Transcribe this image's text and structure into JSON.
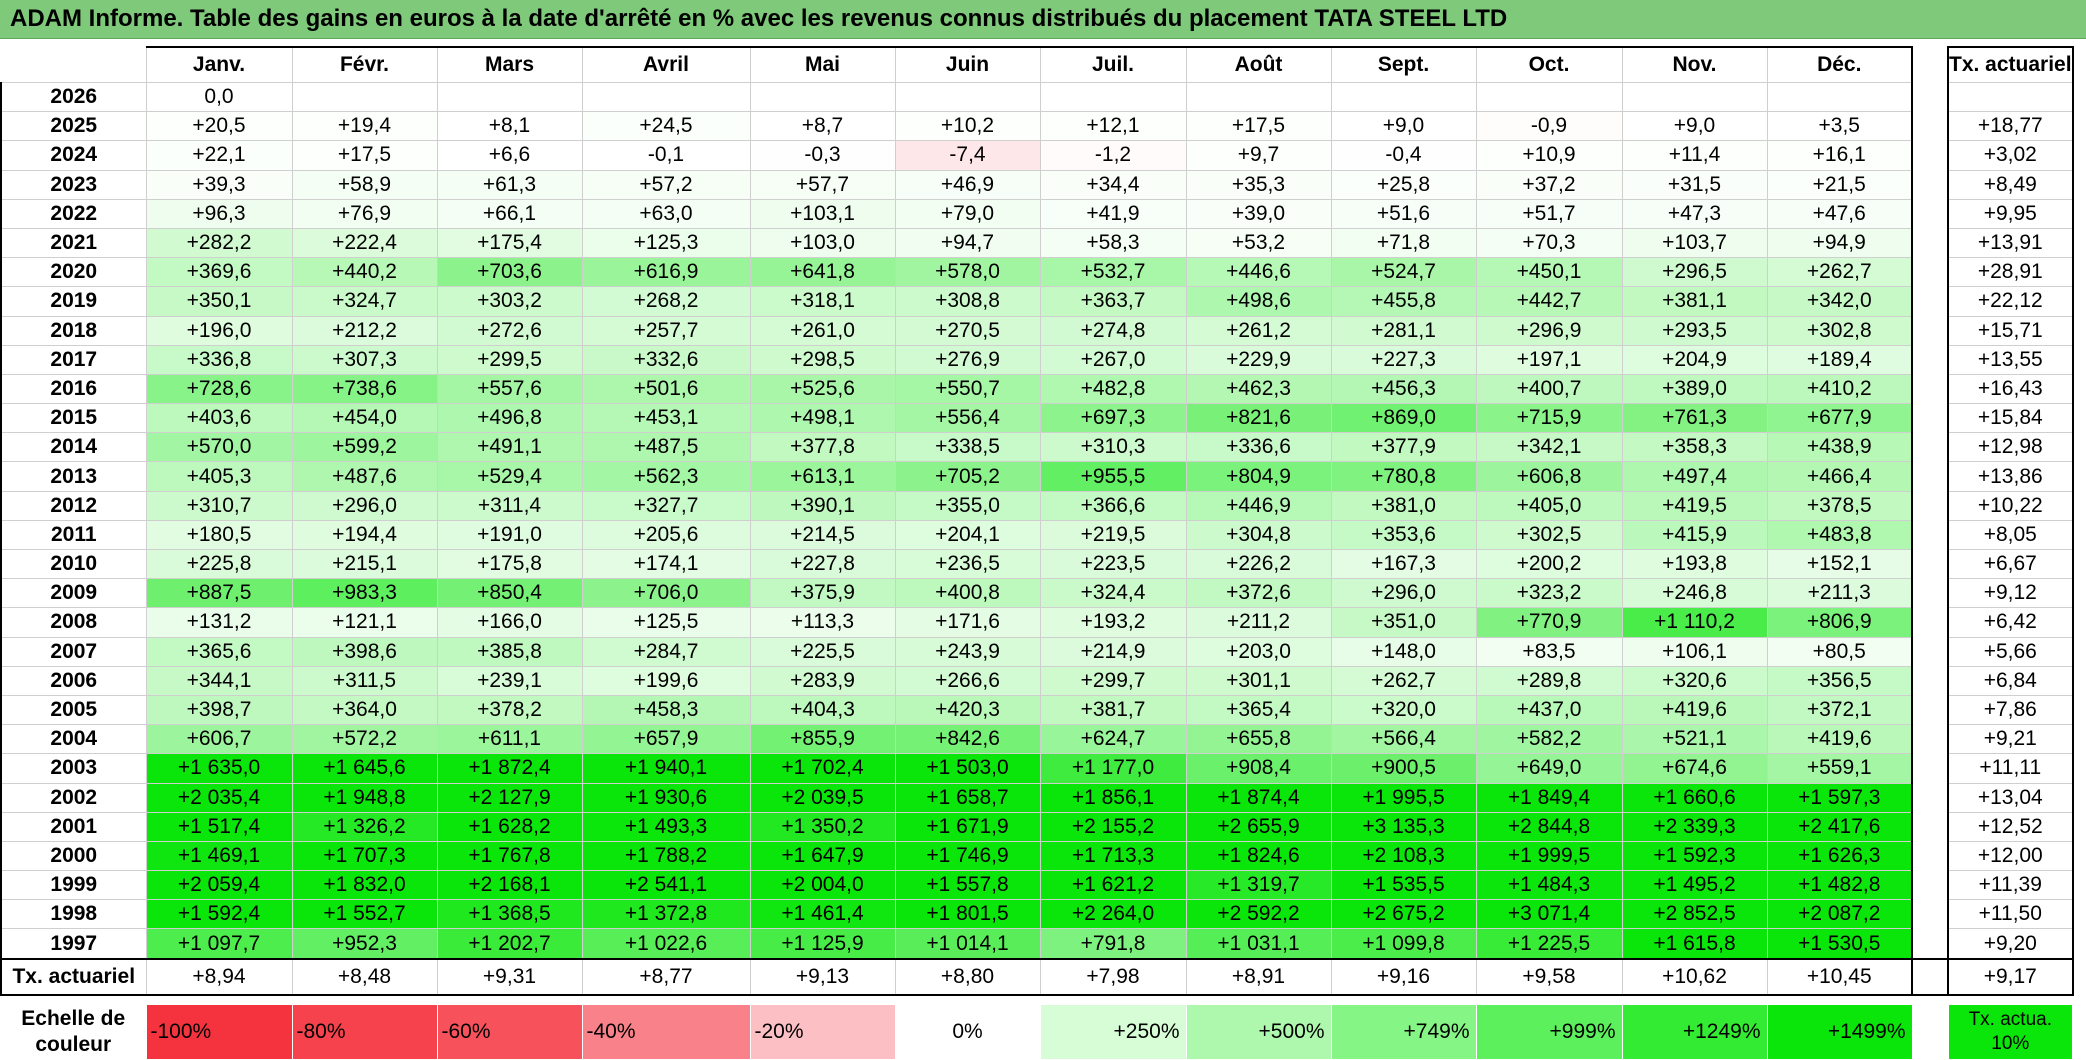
{
  "title": "ADAM Informe. Table des gains en euros à la date d'arrêté en % avec les revenus connus distribués du placement TATA STEEL LTD",
  "months": [
    "Janv.",
    "Févr.",
    "Mars",
    "Avril",
    "Mai",
    "Juin",
    "Juil.",
    "Août",
    "Sept.",
    "Oct.",
    "Nov.",
    "Déc."
  ],
  "tx_header": "Tx. actuariel",
  "rows": [
    {
      "year": "2026",
      "values": [
        "0,0",
        "",
        "",
        "",
        "",
        "",
        "",
        "",
        "",
        "",
        "",
        ""
      ],
      "tx": ""
    },
    {
      "year": "2025",
      "values": [
        "+20,5",
        "+19,4",
        "+8,1",
        "+24,5",
        "+8,7",
        "+10,2",
        "+12,1",
        "+17,5",
        "+9,0",
        "-0,9",
        "+9,0",
        "+3,5"
      ],
      "tx": "+18,77"
    },
    {
      "year": "2024",
      "values": [
        "+22,1",
        "+17,5",
        "+6,6",
        "-0,1",
        "-0,3",
        "-7,4",
        "-1,2",
        "+9,7",
        "-0,4",
        "+10,9",
        "+11,4",
        "+16,1"
      ],
      "tx": "+3,02"
    },
    {
      "year": "2023",
      "values": [
        "+39,3",
        "+58,9",
        "+61,3",
        "+57,2",
        "+57,7",
        "+46,9",
        "+34,4",
        "+35,3",
        "+25,8",
        "+37,2",
        "+31,5",
        "+21,5"
      ],
      "tx": "+8,49"
    },
    {
      "year": "2022",
      "values": [
        "+96,3",
        "+76,9",
        "+66,1",
        "+63,0",
        "+103,1",
        "+79,0",
        "+41,9",
        "+39,0",
        "+51,6",
        "+51,7",
        "+47,3",
        "+47,6"
      ],
      "tx": "+9,95"
    },
    {
      "year": "2021",
      "values": [
        "+282,2",
        "+222,4",
        "+175,4",
        "+125,3",
        "+103,0",
        "+94,7",
        "+58,3",
        "+53,2",
        "+71,8",
        "+70,3",
        "+103,7",
        "+94,9"
      ],
      "tx": "+13,91"
    },
    {
      "year": "2020",
      "values": [
        "+369,6",
        "+440,2",
        "+703,6",
        "+616,9",
        "+641,8",
        "+578,0",
        "+532,7",
        "+446,6",
        "+524,7",
        "+450,1",
        "+296,5",
        "+262,7"
      ],
      "tx": "+28,91"
    },
    {
      "year": "2019",
      "values": [
        "+350,1",
        "+324,7",
        "+303,2",
        "+268,2",
        "+318,1",
        "+308,8",
        "+363,7",
        "+498,6",
        "+455,8",
        "+442,7",
        "+381,1",
        "+342,0"
      ],
      "tx": "+22,12"
    },
    {
      "year": "2018",
      "values": [
        "+196,0",
        "+212,2",
        "+272,6",
        "+257,7",
        "+261,0",
        "+270,5",
        "+274,8",
        "+261,2",
        "+281,1",
        "+296,9",
        "+293,5",
        "+302,8"
      ],
      "tx": "+15,71"
    },
    {
      "year": "2017",
      "values": [
        "+336,8",
        "+307,3",
        "+299,5",
        "+332,6",
        "+298,5",
        "+276,9",
        "+267,0",
        "+229,9",
        "+227,3",
        "+197,1",
        "+204,9",
        "+189,4"
      ],
      "tx": "+13,55"
    },
    {
      "year": "2016",
      "values": [
        "+728,6",
        "+738,6",
        "+557,6",
        "+501,6",
        "+525,6",
        "+550,7",
        "+482,8",
        "+462,3",
        "+456,3",
        "+400,7",
        "+389,0",
        "+410,2"
      ],
      "tx": "+16,43"
    },
    {
      "year": "2015",
      "values": [
        "+403,6",
        "+454,0",
        "+496,8",
        "+453,1",
        "+498,1",
        "+556,4",
        "+697,3",
        "+821,6",
        "+869,0",
        "+715,9",
        "+761,3",
        "+677,9"
      ],
      "tx": "+15,84"
    },
    {
      "year": "2014",
      "values": [
        "+570,0",
        "+599,2",
        "+491,1",
        "+487,5",
        "+377,8",
        "+338,5",
        "+310,3",
        "+336,6",
        "+377,9",
        "+342,1",
        "+358,3",
        "+438,9"
      ],
      "tx": "+12,98"
    },
    {
      "year": "2013",
      "values": [
        "+405,3",
        "+487,6",
        "+529,4",
        "+562,3",
        "+613,1",
        "+705,2",
        "+955,5",
        "+804,9",
        "+780,8",
        "+606,8",
        "+497,4",
        "+466,4"
      ],
      "tx": "+13,86"
    },
    {
      "year": "2012",
      "values": [
        "+310,7",
        "+296,0",
        "+311,4",
        "+327,7",
        "+390,1",
        "+355,0",
        "+366,6",
        "+446,9",
        "+381,0",
        "+405,0",
        "+419,5",
        "+378,5"
      ],
      "tx": "+10,22"
    },
    {
      "year": "2011",
      "values": [
        "+180,5",
        "+194,4",
        "+191,0",
        "+205,6",
        "+214,5",
        "+204,1",
        "+219,5",
        "+304,8",
        "+353,6",
        "+302,5",
        "+415,9",
        "+483,8"
      ],
      "tx": "+8,05"
    },
    {
      "year": "2010",
      "values": [
        "+225,8",
        "+215,1",
        "+175,8",
        "+174,1",
        "+227,8",
        "+236,5",
        "+223,5",
        "+226,2",
        "+167,3",
        "+200,2",
        "+193,8",
        "+152,1"
      ],
      "tx": "+6,67"
    },
    {
      "year": "2009",
      "values": [
        "+887,5",
        "+983,3",
        "+850,4",
        "+706,0",
        "+375,9",
        "+400,8",
        "+324,4",
        "+372,6",
        "+296,0",
        "+323,2",
        "+246,8",
        "+211,3"
      ],
      "tx": "+9,12"
    },
    {
      "year": "2008",
      "values": [
        "+131,2",
        "+121,1",
        "+166,0",
        "+125,5",
        "+113,3",
        "+171,6",
        "+193,2",
        "+211,2",
        "+351,0",
        "+770,9",
        "+1 110,2",
        "+806,9"
      ],
      "tx": "+6,42"
    },
    {
      "year": "2007",
      "values": [
        "+365,6",
        "+398,6",
        "+385,8",
        "+284,7",
        "+225,5",
        "+243,9",
        "+214,9",
        "+203,0",
        "+148,0",
        "+83,5",
        "+106,1",
        "+80,5"
      ],
      "tx": "+5,66"
    },
    {
      "year": "2006",
      "values": [
        "+344,1",
        "+311,5",
        "+239,1",
        "+199,6",
        "+283,9",
        "+266,6",
        "+299,7",
        "+301,1",
        "+262,7",
        "+289,8",
        "+320,6",
        "+356,5"
      ],
      "tx": "+6,84"
    },
    {
      "year": "2005",
      "values": [
        "+398,7",
        "+364,0",
        "+378,2",
        "+458,3",
        "+404,3",
        "+420,3",
        "+381,7",
        "+365,4",
        "+320,0",
        "+437,0",
        "+419,6",
        "+372,1"
      ],
      "tx": "+7,86"
    },
    {
      "year": "2004",
      "values": [
        "+606,7",
        "+572,2",
        "+611,1",
        "+657,9",
        "+855,9",
        "+842,6",
        "+624,7",
        "+655,8",
        "+566,4",
        "+582,2",
        "+521,1",
        "+419,6"
      ],
      "tx": "+9,21"
    },
    {
      "year": "2003",
      "values": [
        "+1 635,0",
        "+1 645,6",
        "+1 872,4",
        "+1 940,1",
        "+1 702,4",
        "+1 503,0",
        "+1 177,0",
        "+908,4",
        "+900,5",
        "+649,0",
        "+674,6",
        "+559,1"
      ],
      "tx": "+11,11"
    },
    {
      "year": "2002",
      "values": [
        "+2 035,4",
        "+1 948,8",
        "+2 127,9",
        "+1 930,6",
        "+2 039,5",
        "+1 658,7",
        "+1 856,1",
        "+1 874,4",
        "+1 995,5",
        "+1 849,4",
        "+1 660,6",
        "+1 597,3"
      ],
      "tx": "+13,04"
    },
    {
      "year": "2001",
      "values": [
        "+1 517,4",
        "+1 326,2",
        "+1 628,2",
        "+1 493,3",
        "+1 350,2",
        "+1 671,9",
        "+2 155,2",
        "+2 655,9",
        "+3 135,3",
        "+2 844,8",
        "+2 339,3",
        "+2 417,6"
      ],
      "tx": "+12,52"
    },
    {
      "year": "2000",
      "values": [
        "+1 469,1",
        "+1 707,3",
        "+1 767,8",
        "+1 788,2",
        "+1 647,9",
        "+1 746,9",
        "+1 713,3",
        "+1 824,6",
        "+2 108,3",
        "+1 999,5",
        "+1 592,3",
        "+1 626,3"
      ],
      "tx": "+12,00"
    },
    {
      "year": "1999",
      "values": [
        "+2 059,4",
        "+1 832,0",
        "+2 168,1",
        "+2 541,1",
        "+2 004,0",
        "+1 557,8",
        "+1 621,2",
        "+1 319,7",
        "+1 535,5",
        "+1 484,3",
        "+1 495,2",
        "+1 482,8"
      ],
      "tx": "+11,39"
    },
    {
      "year": "1998",
      "values": [
        "+1 592,4",
        "+1 552,7",
        "+1 368,5",
        "+1 372,8",
        "+1 461,4",
        "+1 801,5",
        "+2 264,0",
        "+2 592,2",
        "+2 675,2",
        "+3 071,4",
        "+2 852,5",
        "+2 087,2"
      ],
      "tx": "+11,50"
    },
    {
      "year": "1997",
      "values": [
        "+1 097,7",
        "+952,3",
        "+1 202,7",
        "+1 022,6",
        "+1 125,9",
        "+1 014,1",
        "+791,8",
        "+1 031,1",
        "+1 099,8",
        "+1 225,5",
        "+1 615,8",
        "+1 530,5"
      ],
      "tx": "+9,20"
    }
  ],
  "footer": {
    "label": "Tx. actuariel",
    "values": [
      "+8,94",
      "+8,48",
      "+9,31",
      "+8,77",
      "+9,13",
      "+8,80",
      "+7,98",
      "+8,91",
      "+9,16",
      "+9,58",
      "+10,62",
      "+10,45"
    ],
    "total": "+9,17"
  },
  "scale": {
    "label": "Echelle de couleur",
    "items": [
      {
        "text": "-100%",
        "color": "#f5333f"
      },
      {
        "text": "-80%",
        "color": "#f6424d"
      },
      {
        "text": "-60%",
        "color": "#f7525c"
      },
      {
        "text": "-40%",
        "color": "#f98189"
      },
      {
        "text": "-20%",
        "color": "#fcc0c4"
      },
      {
        "text": "0%",
        "color": "#ffffff"
      },
      {
        "text": "+250%",
        "color": "#d6fdd6"
      },
      {
        "text": "+500%",
        "color": "#aef8ae"
      },
      {
        "text": "+749%",
        "color": "#85f585"
      },
      {
        "text": "+999%",
        "color": "#5cf05c"
      },
      {
        "text": "+1249%",
        "color": "#33eb33"
      },
      {
        "text": "+1499%",
        "color": "#0ae60a"
      }
    ],
    "tx_label": "Tx. actua. 10%",
    "tx_color": "#0ae60a"
  }
}
